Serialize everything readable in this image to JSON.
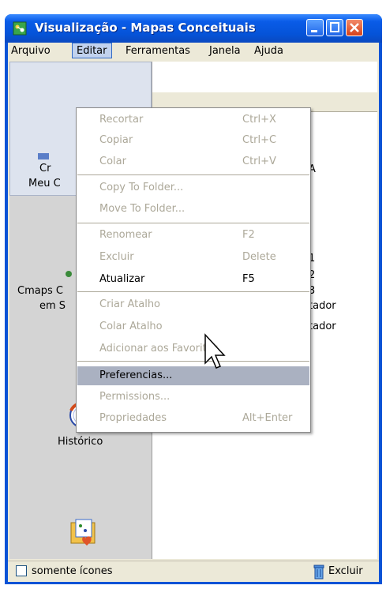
{
  "window": {
    "title": "Visualização - Mapas Conceituais",
    "colors": {
      "titlebar": "#0a5ce8",
      "menu_highlight": "#aab1c1",
      "disabled_text": "#aca899"
    }
  },
  "menubar": {
    "items": [
      "Arquivo",
      "Editar",
      "Ferramentas",
      "Janela",
      "Ajuda"
    ],
    "active": "Editar"
  },
  "left_panel": {
    "fragments": [
      "Cr",
      "Meu C",
      "Cmaps C",
      "em S"
    ],
    "historico_label": "Histórico",
    "icons": [
      "cmap-icon",
      "historico-icon",
      "favorites-folder-icon"
    ]
  },
  "right_panel": {
    "fragments": [
      "A",
      "1",
      "2",
      "3",
      "tador",
      "tador"
    ]
  },
  "edit_menu": {
    "items": [
      {
        "label": "Recortar",
        "shortcut": "Ctrl+X",
        "enabled": false
      },
      {
        "label": "Copiar",
        "shortcut": "Ctrl+C",
        "enabled": false
      },
      {
        "label": "Colar",
        "shortcut": "Ctrl+V",
        "enabled": false
      },
      {
        "label": "Copy To Folder...",
        "shortcut": "",
        "enabled": false
      },
      {
        "label": "Move To Folder...",
        "shortcut": "",
        "enabled": false
      },
      {
        "label": "Renomear",
        "shortcut": "F2",
        "enabled": false
      },
      {
        "label": "Excluir",
        "shortcut": "Delete",
        "enabled": false
      },
      {
        "label": "Atualizar",
        "shortcut": "F5",
        "enabled": true
      },
      {
        "label": "Criar Atalho",
        "shortcut": "",
        "enabled": false
      },
      {
        "label": "Colar Atalho",
        "shortcut": "",
        "enabled": false
      },
      {
        "label": "Adicionar aos Favoritos",
        "shortcut": "",
        "enabled": false
      },
      {
        "label": "Preferencias...",
        "shortcut": "",
        "enabled": true,
        "highlighted": true
      },
      {
        "label": "Permissions...",
        "shortcut": "",
        "enabled": false
      },
      {
        "label": "Propriedades",
        "shortcut": "Alt+Enter",
        "enabled": false
      }
    ]
  },
  "statusbar": {
    "checkbox_label": "somente ícones",
    "checkbox_checked": false,
    "delete_label": "Excluir"
  }
}
